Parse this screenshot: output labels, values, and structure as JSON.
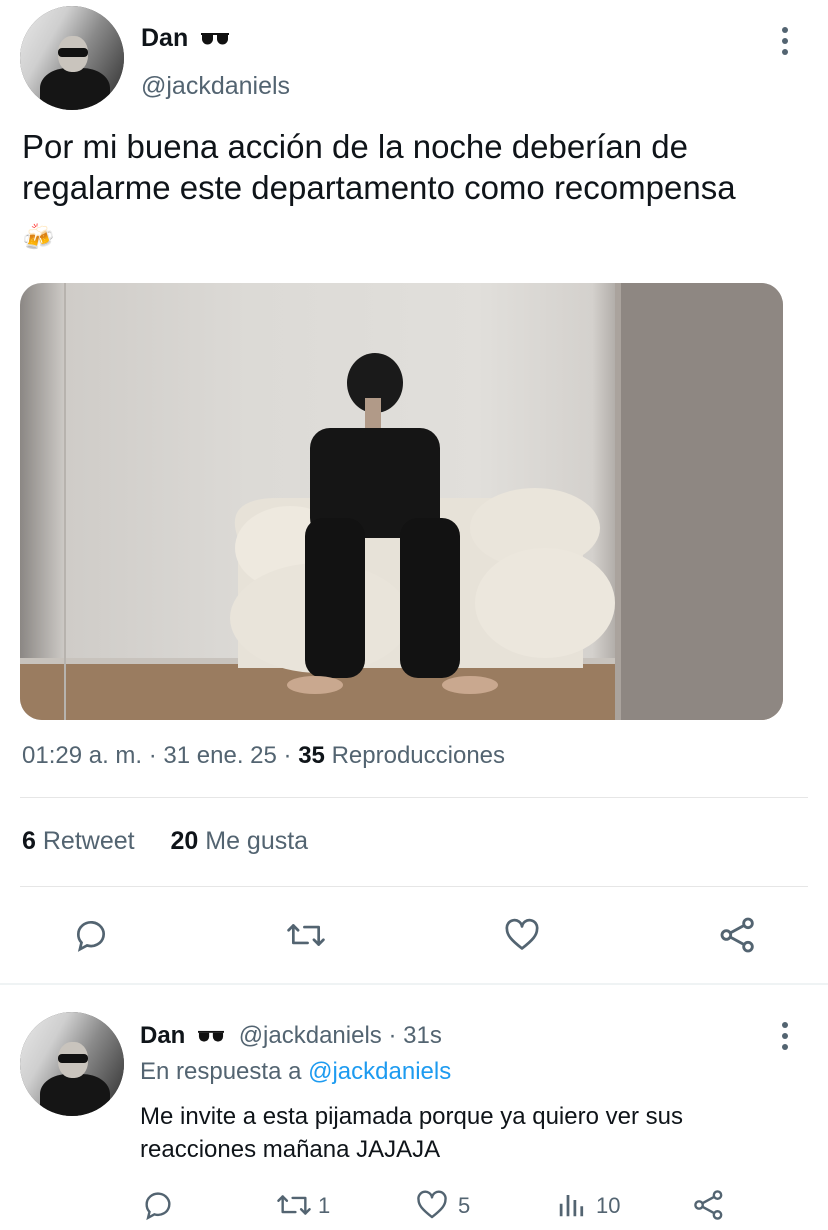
{
  "main_tweet": {
    "author_name": "Dan",
    "author_emoji": "🕶️",
    "author_handle": "@jackdaniels",
    "text": "Por mi buena acción de la noche deberían de regalarme este departamento como recompensa",
    "emoji": "🍻",
    "time": "01:29 a. m.",
    "date": "31 ene. 25",
    "views_count": "35",
    "views_label": "Reproducciones",
    "retweets_count": "6",
    "retweets_label": "Retweet",
    "likes_count": "20",
    "likes_label": "Me gusta",
    "separator": "·"
  },
  "reply": {
    "author_name": "Dan",
    "author_handle": "@jackdaniels",
    "time_ago": "31s",
    "in_reply_to_label": "En respuesta a",
    "in_reply_to_handle": "@jackdaniels",
    "text": "Me invite a esta pijamada porque ya quiero ver sus reacciones mañana JAJAJA",
    "retweet_count": "1",
    "like_count": "5",
    "views_count": "10"
  },
  "icons": [
    "sunglasses-icon",
    "more-icon",
    "beer-icon",
    "reply-icon",
    "retweet-icon",
    "like-icon",
    "share-icon",
    "views-icon"
  ],
  "colors": {
    "text": "#0f1419",
    "secondary": "#536471",
    "link": "#1d9bf0",
    "divider": "#e6e6e6"
  }
}
